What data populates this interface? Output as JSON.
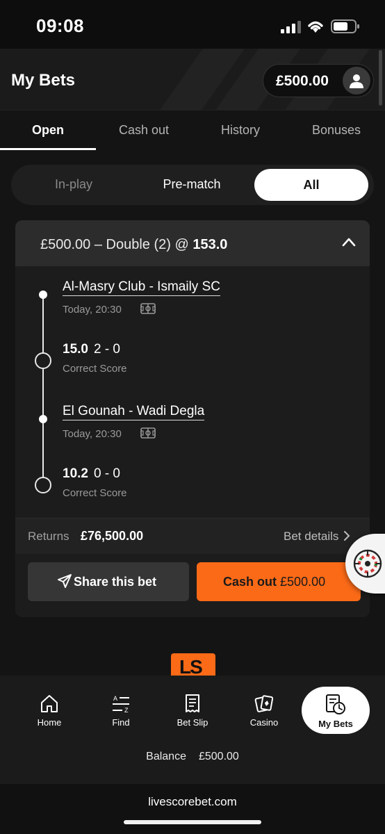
{
  "status_bar": {
    "time": "09:08"
  },
  "header": {
    "title": "My Bets",
    "balance": "£500.00"
  },
  "tabs": [
    {
      "label": "Open"
    },
    {
      "label": "Cash out"
    },
    {
      "label": "History"
    },
    {
      "label": "Bonuses"
    }
  ],
  "filter": {
    "options": [
      "In-play",
      "Pre-match",
      "All"
    ],
    "selected": "All"
  },
  "bet": {
    "summary_prefix": "£500.00 – Double (2) @",
    "odds": "153.0",
    "legs": [
      {
        "match": "Al-Masry Club - Ismaily SC",
        "time": "Today, 20:30",
        "price": "15.0",
        "score": "2 - 0",
        "market": "Correct Score"
      },
      {
        "match": "El Gounah - Wadi Degla",
        "time": "Today, 20:30",
        "price": "10.2",
        "score": "0 - 0",
        "market": "Correct Score"
      }
    ],
    "returns_label": "Returns",
    "returns_value": "£76,500.00",
    "bet_details_label": "Bet details",
    "share_label": "Share this bet",
    "cashout_label": "Cash out",
    "cashout_amount": "£500.00"
  },
  "logo_text": "LS",
  "bottom_nav": [
    {
      "label": "Home",
      "icon": "home-icon"
    },
    {
      "label": "Find",
      "icon": "sort-az-icon"
    },
    {
      "label": "Bet Slip",
      "icon": "receipt-icon"
    },
    {
      "label": "Casino",
      "icon": "playing-cards-icon"
    },
    {
      "label": "My Bets",
      "icon": "bets-clock-icon"
    }
  ],
  "balance_line": {
    "label": "Balance",
    "value": "£500.00"
  },
  "browser": {
    "url": "livescorebet.com"
  },
  "colors": {
    "accent": "#fb6a17",
    "background": "#141414",
    "card": "#1c1c1c"
  }
}
